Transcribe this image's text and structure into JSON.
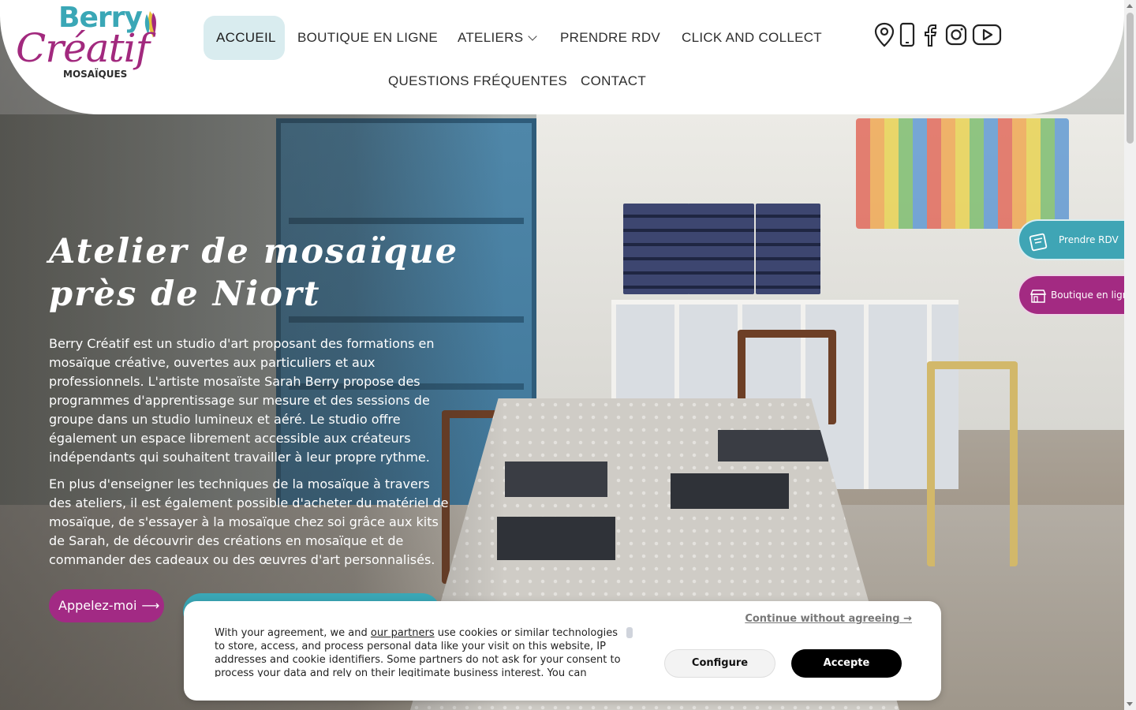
{
  "brand": {
    "logo_line1": "Berry",
    "logo_line2": "Créatif",
    "logo_line3": "MOSAÏQUES",
    "colors": {
      "teal": "#3aa7b6",
      "magenta": "#a2297e",
      "nav_active_bg": "#d9ecef"
    }
  },
  "nav": {
    "items": [
      {
        "label": "ACCUEIL",
        "active": true
      },
      {
        "label": "BOUTIQUE EN LIGNE"
      },
      {
        "label": "ATELIERS",
        "has_dropdown": true
      },
      {
        "label": "PRENDRE RDV"
      },
      {
        "label": "CLICK AND COLLECT"
      },
      {
        "label": "QUESTIONS FRÉQUENTES"
      },
      {
        "label": "CONTACT"
      }
    ]
  },
  "social_icons": [
    "location-icon",
    "phone-icon",
    "facebook-icon",
    "instagram-icon",
    "youtube-icon"
  ],
  "hero": {
    "title": "Atelier de mosaïque près de Niort",
    "paragraph1": "Berry Créatif est un studio d'art proposant des formations en mosaïque créative, ouvertes aux particuliers et aux professionnels. L'artiste mosaïste Sarah Berry propose des programmes d'apprentissage sur mesure et des sessions de groupe dans un studio lumineux et aéré. Le studio offre également un espace librement accessible aux créateurs indépendants qui souhaitent travailler à leur propre rythme.",
    "paragraph2": "En plus d'enseigner les techniques de la mosaïque à travers des ateliers, il est également possible d'acheter du matériel de mosaïque, de s'essayer à la mosaïque chez soi grâce aux kits de Sarah, de découvrir des créations en mosaïque et de commander des cadeaux ou des œuvres d'art personnalisés.",
    "call_button": "Appelez-moi",
    "call_arrow": "⟶"
  },
  "side_tabs": {
    "rdv": "Prendre RDV",
    "shop": "Boutique en ligne"
  },
  "cookie": {
    "continue_link": "Continue without agreeing →",
    "text_before": "With your agreement, we and ",
    "partners_link": "our partners",
    "text_after": " use cookies or similar technologies to store, access, and process personal data like your visit on this website, IP addresses and cookie identifiers. Some partners do not ask for your consent to process your data and rely on their legitimate business interest. You can",
    "configure": "Configure",
    "accept": "Accepte"
  }
}
